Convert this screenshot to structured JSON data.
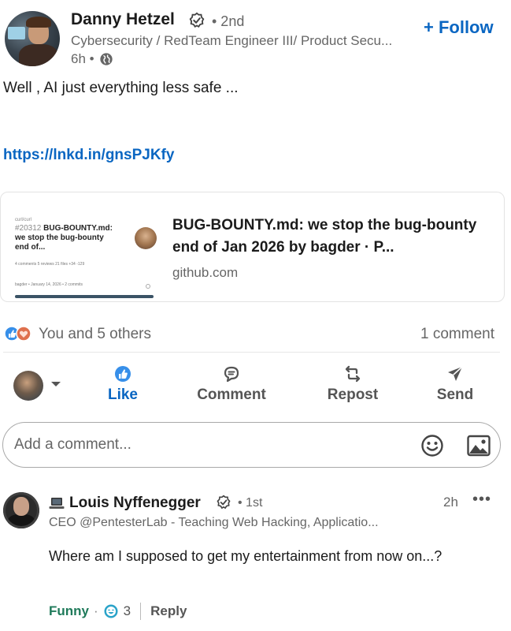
{
  "post": {
    "author_name": "Danny Hetzel",
    "degree": "• 2nd",
    "headline": "Cybersecurity / RedTeam Engineer III/ Product Secu...",
    "time": "6h •",
    "follow_label": "+ Follow",
    "text": "Well , AI just everything less safe ...",
    "link": "https://lnkd.in/gnsPJKfy"
  },
  "preview": {
    "thumb_user": "curl/curl",
    "thumb_number": "#20312",
    "thumb_title": " BUG-BOUNTY.md: we stop the bug-bounty end of...",
    "thumb_meta": "4 comments   5 reviews   21 files   +34 -129",
    "thumb_meta2": "bagder • January 14, 2026 • 2 commits",
    "title": "BUG-BOUNTY.md: we stop the bug-bounty end of Jan 2026 by bagder · P...",
    "domain": "github.com"
  },
  "social": {
    "reactors": "You and 5 others",
    "comments": "1 comment"
  },
  "actions": {
    "like": "Like",
    "comment": "Comment",
    "repost": "Repost",
    "send": "Send"
  },
  "comment_box": {
    "placeholder": "Add a comment..."
  },
  "comment": {
    "author_name": "Louis Nyffenegger",
    "degree": "• 1st",
    "time": "2h",
    "more": "•••",
    "headline": "CEO @PentesterLab - Teaching Web Hacking, Applicatio...",
    "text": "Where am I supposed to get my entertainment from now on...?",
    "reaction": "Funny",
    "dot": "·",
    "reaction_count": "3",
    "reply": "Reply"
  },
  "colors": {
    "brand": "#0a66c2",
    "funny": "#1f7a5a",
    "muted": "#666666"
  },
  "icons": [
    "verified-icon",
    "globe-icon",
    "reactions-icon",
    "like-icon",
    "comment-icon",
    "repost-icon",
    "send-icon",
    "chevron-down-icon",
    "emoji-icon",
    "image-icon",
    "laptop-icon",
    "funny-reaction-icon"
  ]
}
